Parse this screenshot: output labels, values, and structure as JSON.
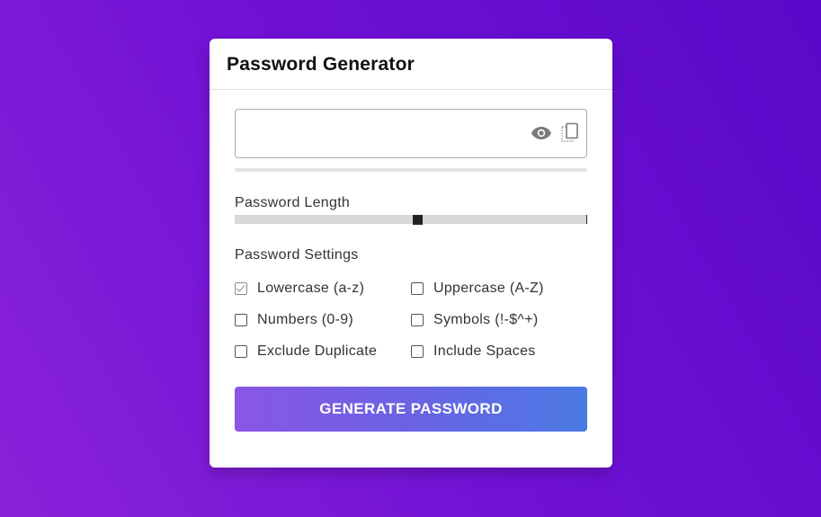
{
  "card": {
    "title": "Password Generator"
  },
  "password": {
    "value": "",
    "placeholder": ""
  },
  "icons": {
    "visibility": "eye-icon",
    "copy": "copy-icon"
  },
  "length": {
    "label": "Password Length",
    "value_fraction": 0.518
  },
  "settings": {
    "label": "Password Settings",
    "options": [
      {
        "label": "Lowercase (a-z)",
        "checked": true
      },
      {
        "label": "Uppercase (A-Z)",
        "checked": false
      },
      {
        "label": "Numbers (0-9)",
        "checked": false
      },
      {
        "label": "Symbols (!-$^+)",
        "checked": false
      },
      {
        "label": "Exclude Duplicate",
        "checked": false
      },
      {
        "label": "Include Spaces",
        "checked": false
      }
    ]
  },
  "generate_button": {
    "label": "GENERATE PASSWORD"
  },
  "colors": {
    "background_start": "#8a22d8",
    "background_end": "#5a08c9",
    "button_start": "#8a56e6",
    "button_end": "#4a7ae4"
  }
}
